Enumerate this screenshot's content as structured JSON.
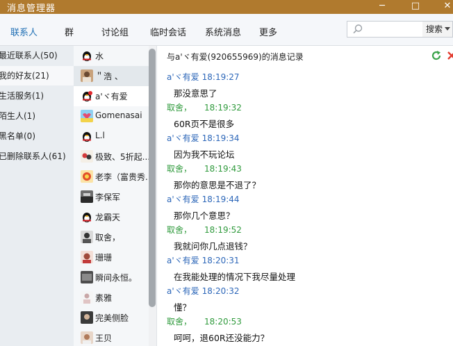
{
  "window": {
    "title": "消息管理器",
    "min": "─",
    "max": "□",
    "close": "✕"
  },
  "tabs": [
    "联系人",
    "群",
    "讨论组",
    "临时会话",
    "系统消息",
    "更多"
  ],
  "search": {
    "placeholder": "",
    "button": "搜索"
  },
  "categories": [
    "最近联系人(50)",
    "我的好友(21)",
    "生活服务(1)",
    "陌生人(1)",
    "黑名单(0)",
    "已删除联系人(61)"
  ],
  "contacts": [
    {
      "name": "水",
      "icon": "qq-penguin-icon"
    },
    {
      "name": "＂浩 、",
      "icon": "photo-avatar"
    },
    {
      "name": "a'ヾ有爱",
      "icon": "qq-penguin-icon"
    },
    {
      "name": "Gomenasai",
      "icon": "photo-avatar"
    },
    {
      "name": "L.l",
      "icon": "qq-penguin-icon"
    },
    {
      "name": "极致、5折起...",
      "icon": "photo-avatar"
    },
    {
      "name": "老李（富贵秀...",
      "icon": "photo-avatar"
    },
    {
      "name": "李保军",
      "icon": "photo-avatar"
    },
    {
      "name": "龙霸天",
      "icon": "qq-penguin-icon"
    },
    {
      "name": "取舍，",
      "icon": "photo-avatar"
    },
    {
      "name": "珊珊",
      "icon": "photo-avatar"
    },
    {
      "name": "瞬间永恒。",
      "icon": "photo-avatar"
    },
    {
      "name": "素雅",
      "icon": "photo-avatar"
    },
    {
      "name": "完美侧脸",
      "icon": "photo-avatar"
    },
    {
      "name": "王贝",
      "icon": "photo-avatar"
    }
  ],
  "history": {
    "header": "与a'ヾ有爱(920655969)的消息记录",
    "messages": [
      {
        "sender": "a'ヾ有爱",
        "time": "18:19:27",
        "text": "那没意思了",
        "side": "them"
      },
      {
        "sender": "取舍，",
        "time": "18:19:32",
        "text": "60R页不是很多",
        "side": "me"
      },
      {
        "sender": "a'ヾ有爱",
        "time": "18:19:34",
        "text": "因为我不玩论坛",
        "side": "them"
      },
      {
        "sender": "取舍，",
        "time": "18:19:43",
        "text": "那你的意思是不退了？",
        "side": "me"
      },
      {
        "sender": "a'ヾ有爱",
        "time": "18:19:44",
        "text": "那你几个意思？",
        "side": "them"
      },
      {
        "sender": "取舍，",
        "time": "18:19:52",
        "text": "我就问你几点退钱？",
        "side": "me"
      },
      {
        "sender": "a'ヾ有爱",
        "time": "18:20:31",
        "text": "在我能处理的情况下我尽量处理",
        "side": "them"
      },
      {
        "sender": "a'ヾ有爱",
        "time": "18:20:32",
        "text": "懂？",
        "side": "them"
      },
      {
        "sender": "取舍，",
        "time": "18:20:53",
        "text": "呵呵，退60R还没能力？",
        "side": "me"
      }
    ]
  },
  "colors": {
    "titlebar": "#b07a2e",
    "tab_active": "#1f6fb4",
    "sender_them": "#2d67b9",
    "sender_me": "#2f9a3c"
  }
}
